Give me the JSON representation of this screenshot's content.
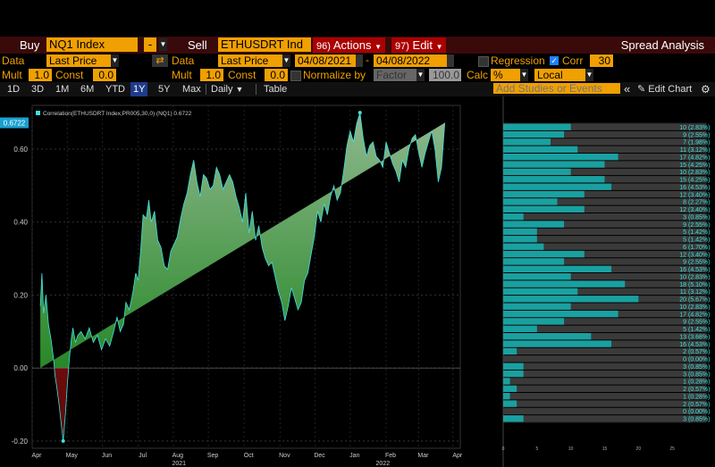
{
  "toolbar": {
    "buy_label": "Buy",
    "buy_ticker": "NQ1 Index",
    "minus_label": "-",
    "sell_label": "Sell",
    "sell_ticker": "ETHUSDRT Ind",
    "actions_num": "96)",
    "actions_label": "Actions",
    "edit_num": "97)",
    "edit_label": "Edit",
    "spread_analysis": "Spread Analysis"
  },
  "row2": {
    "data_label": "Data",
    "data1": "Last Price",
    "data2_label": "Data",
    "data2": "Last Price",
    "start_date": "04/08/2021",
    "dash": "-",
    "end_date": "04/08/2022",
    "regression_label": "Regression",
    "corr_label": "Corr",
    "corr_value": "30"
  },
  "row3": {
    "mult_label": "Mult",
    "mult1": "1.0",
    "const_label": "Const",
    "const1": "0.0",
    "mult2_label": "Mult",
    "mult2": "1.0",
    "const2_label": "Const",
    "const2": "0.0",
    "normalize_label": "Normalize by",
    "factor": "Factor",
    "factor_value": "100.0",
    "calc_label": "Calc",
    "calc_value": "%",
    "local_value": "Local"
  },
  "row4": {
    "timeframes": [
      "1D",
      "3D",
      "1M",
      "6M",
      "YTD",
      "1Y",
      "5Y",
      "Max"
    ],
    "active_timeframe": "1Y",
    "frequency": "Daily",
    "table_label": "Table",
    "add_studies_placeholder": "Add Studies or Events",
    "edit_chart": "Edit Chart"
  },
  "colors": {
    "amber": "#f0a000",
    "dark_red": "#a00000",
    "area_green": "#1a8a1a",
    "area_red": "#8a1a1a",
    "line_cyan": "#40e0e0",
    "hist_cyan": "#1aa0a0",
    "hist_grey": "#444444"
  },
  "chart_data": [
    {
      "type": "area",
      "legend": "Correlation(ETHUSDRT Index,PR005,30,0) (NQ1) 0.6722",
      "last_value_label": "0.6722",
      "ylim": [
        -0.22,
        0.72
      ],
      "yticks": [
        -0.2,
        0.0,
        0.2,
        0.4,
        0.6
      ],
      "ytick_labels": [
        "-0.20",
        "0.00",
        "0.20",
        "0.40",
        "0.60"
      ],
      "xlim": [
        0,
        52.5
      ],
      "xtick_positions": [
        0,
        4.3,
        8.6,
        13,
        17.3,
        21.6,
        26,
        30.4,
        34.7,
        39,
        43.4,
        47.4,
        51.6
      ],
      "xtick_labels": [
        "Apr",
        "May",
        "Jun",
        "Jul",
        "Aug",
        "Sep",
        "Oct",
        "Nov",
        "Dec",
        "Jan",
        "Feb",
        "Mar",
        "Apr"
      ],
      "year_labels": [
        {
          "x": 18,
          "label": "2021"
        },
        {
          "x": 43,
          "label": "2022"
        }
      ],
      "x": [
        1.0,
        1.2,
        1.4,
        1.7,
        2.0,
        2.3,
        2.6,
        2.8,
        3.0,
        3.3,
        3.6,
        3.8,
        4.1,
        4.3,
        4.5,
        4.8,
        5.0,
        5.3,
        5.6,
        6.0,
        6.5,
        7.0,
        7.5,
        8.0,
        8.5,
        9.0,
        9.5,
        10.0,
        10.4,
        10.8,
        11.2,
        11.5,
        11.9,
        12.3,
        12.7,
        13.0,
        13.3,
        13.6,
        14.0,
        14.3,
        14.6,
        15.0,
        15.4,
        15.8,
        16.2,
        16.6,
        17.0,
        17.4,
        17.8,
        18.2,
        18.6,
        19.0,
        19.4,
        19.8,
        20.2,
        20.6,
        21.0,
        21.4,
        21.8,
        22.2,
        22.6,
        23.0,
        23.4,
        23.8,
        24.2,
        24.6,
        25.0,
        25.4,
        25.8,
        26.2,
        26.6,
        27.0,
        27.4,
        27.8,
        28.2,
        28.6,
        29.0,
        29.4,
        29.8,
        30.2,
        30.6,
        31.0,
        31.4,
        31.8,
        32.2,
        32.6,
        33.0,
        33.4,
        33.8,
        34.2,
        34.6,
        35.0,
        35.4,
        35.8,
        36.2,
        36.6,
        37.0,
        37.4,
        37.8,
        38.2,
        38.6,
        39.0,
        39.4,
        39.8,
        40.2,
        40.6,
        41.0,
        41.4,
        41.8,
        42.2,
        42.6,
        43.0,
        43.4,
        43.8,
        44.2,
        44.6,
        45.0,
        45.4,
        45.8,
        46.2,
        46.6,
        47.0,
        47.4,
        47.8,
        48.2,
        48.6,
        49.0,
        49.4,
        49.8,
        50.2,
        50.6,
        51.0,
        51.3
      ],
      "y": [
        0.17,
        0.26,
        0.15,
        0.2,
        0.12,
        0.08,
        0.03,
        -0.02,
        -0.05,
        -0.1,
        -0.16,
        -0.2,
        -0.12,
        -0.05,
        0.01,
        0.08,
        0.11,
        0.07,
        0.09,
        0.1,
        0.08,
        0.11,
        0.07,
        0.09,
        0.05,
        0.08,
        0.06,
        0.1,
        0.14,
        0.1,
        0.12,
        0.18,
        0.16,
        0.2,
        0.26,
        0.24,
        0.32,
        0.42,
        0.41,
        0.46,
        0.4,
        0.43,
        0.35,
        0.33,
        0.28,
        0.27,
        0.32,
        0.34,
        0.36,
        0.41,
        0.45,
        0.48,
        0.53,
        0.57,
        0.51,
        0.47,
        0.53,
        0.52,
        0.49,
        0.5,
        0.55,
        0.53,
        0.49,
        0.51,
        0.53,
        0.51,
        0.47,
        0.44,
        0.4,
        0.48,
        0.37,
        0.43,
        0.35,
        0.39,
        0.33,
        0.3,
        0.28,
        0.29,
        0.25,
        0.21,
        0.18,
        0.13,
        0.17,
        0.22,
        0.19,
        0.16,
        0.18,
        0.24,
        0.26,
        0.31,
        0.36,
        0.43,
        0.4,
        0.45,
        0.42,
        0.47,
        0.5,
        0.46,
        0.48,
        0.54,
        0.61,
        0.65,
        0.62,
        0.67,
        0.7,
        0.63,
        0.58,
        0.61,
        0.62,
        0.58,
        0.57,
        0.55,
        0.62,
        0.59,
        0.56,
        0.54,
        0.51,
        0.57,
        0.55,
        0.6,
        0.63,
        0.64,
        0.59,
        0.55,
        0.59,
        0.62,
        0.65,
        0.6,
        0.51,
        0.55,
        0.6722
      ]
    },
    {
      "type": "bar",
      "orientation": "horizontal",
      "xlim": [
        0,
        30
      ],
      "xticks": [
        0,
        5,
        10,
        15,
        20,
        25
      ],
      "bins": [
        {
          "count": 10,
          "label": "(2.83%)"
        },
        {
          "count": 9,
          "label": "(2.55%)"
        },
        {
          "count": 7,
          "label": "(1.98%)"
        },
        {
          "count": 11,
          "label": "(3.12%)"
        },
        {
          "count": 17,
          "label": "(4.82%)"
        },
        {
          "count": 15,
          "label": "(4.25%)"
        },
        {
          "count": 10,
          "label": "(2.83%)"
        },
        {
          "count": 15,
          "label": "(4.25%)"
        },
        {
          "count": 16,
          "label": "(4.53%)"
        },
        {
          "count": 12,
          "label": "(3.40%)"
        },
        {
          "count": 8,
          "label": "(2.27%)"
        },
        {
          "count": 12,
          "label": "(3.40%)"
        },
        {
          "count": 3,
          "label": "(0.85%)"
        },
        {
          "count": 9,
          "label": "(2.55%)"
        },
        {
          "count": 5,
          "label": "(1.42%)"
        },
        {
          "count": 5,
          "label": "(1.42%)"
        },
        {
          "count": 6,
          "label": "(1.70%)"
        },
        {
          "count": 12,
          "label": "(3.40%)"
        },
        {
          "count": 9,
          "label": "(2.55%)"
        },
        {
          "count": 16,
          "label": "(4.53%)"
        },
        {
          "count": 10,
          "label": "(2.83%)"
        },
        {
          "count": 18,
          "label": "(5.10%)"
        },
        {
          "count": 11,
          "label": "(3.12%)"
        },
        {
          "count": 20,
          "label": "(5.67%)"
        },
        {
          "count": 10,
          "label": "(2.83%)"
        },
        {
          "count": 17,
          "label": "(4.82%)"
        },
        {
          "count": 9,
          "label": "(2.55%)"
        },
        {
          "count": 5,
          "label": "(1.42%)"
        },
        {
          "count": 13,
          "label": "(3.68%)"
        },
        {
          "count": 16,
          "label": "(4.53%)"
        },
        {
          "count": 2,
          "label": "(0.57%)"
        },
        {
          "count": 0,
          "label": "(0.00%)"
        },
        {
          "count": 3,
          "label": "(0.85%)"
        },
        {
          "count": 3,
          "label": "(0.85%)"
        },
        {
          "count": 1,
          "label": "(0.28%)"
        },
        {
          "count": 2,
          "label": "(0.57%)"
        },
        {
          "count": 1,
          "label": "(0.28%)"
        },
        {
          "count": 2,
          "label": "(0.57%)"
        },
        {
          "count": 0,
          "label": "(0.00%)"
        },
        {
          "count": 3,
          "label": "(0.85%)"
        }
      ]
    }
  ]
}
